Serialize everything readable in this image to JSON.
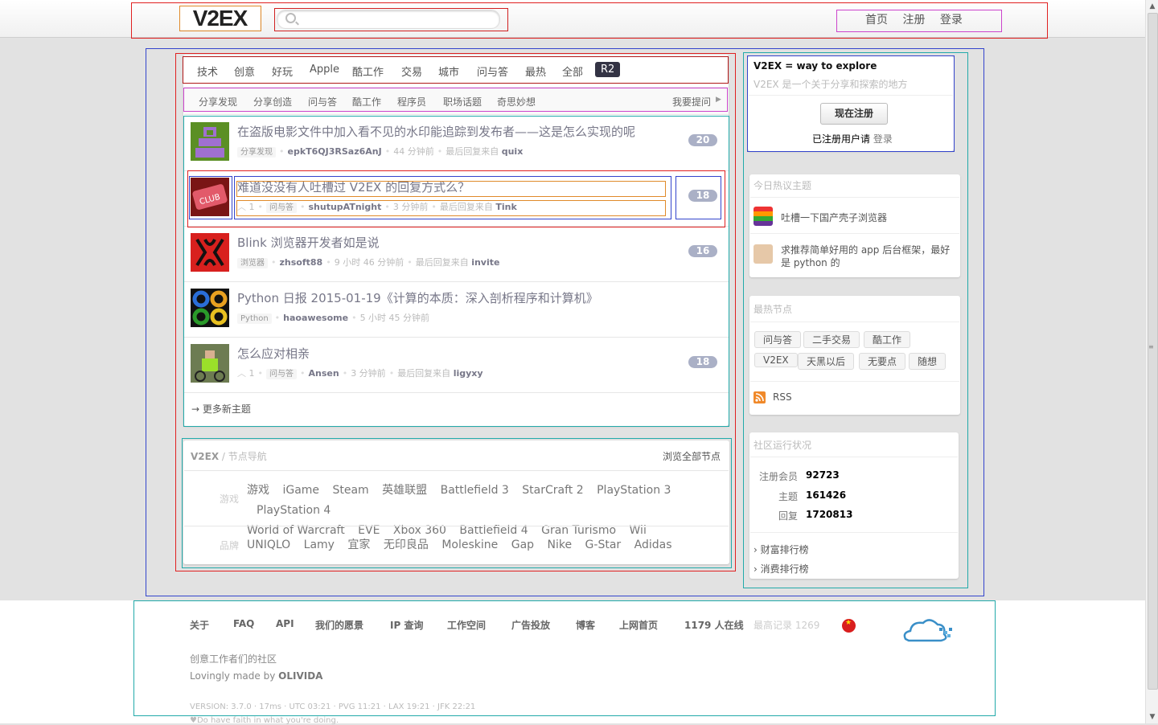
{
  "header": {
    "logo": "V2EX",
    "search_placeholder": "",
    "nav": [
      "首页",
      "注册",
      "登录"
    ]
  },
  "tabs": [
    "技术",
    "创意",
    "好玩",
    "Apple",
    "酷工作",
    "交易",
    "城市",
    "问与答",
    "最热",
    "全部",
    "R2"
  ],
  "subtabs": [
    "分享发现",
    "分享创造",
    "问与答",
    "酷工作",
    "程序员",
    "职场话题",
    "奇思妙想"
  ],
  "ask_link": "我要提问",
  "topics": [
    {
      "title": "在盗版电影文件中加入看不见的水印能追踪到发布者——这是怎么实现的呢",
      "votes": "",
      "node": "分享发现",
      "user": "epkT6QJ3RSaz6AnJ",
      "time": "44 分钟前",
      "last_prefix": "最后回复来自",
      "last_user": "quix",
      "count": "20"
    },
    {
      "title": "难道没没有人吐槽过 V2EX 的回复方式么？",
      "votes": "1",
      "node": "问与答",
      "user": "shutupATnight",
      "time": "3 分钟前",
      "last_prefix": "最后回复来自",
      "last_user": "Tink",
      "count": "18"
    },
    {
      "title": "Blink 浏览器开发者如是说",
      "votes": "",
      "node": "浏览器",
      "user": "zhsoft88",
      "time": "9 小时 46 分钟前",
      "last_prefix": "最后回复来自",
      "last_user": "invite",
      "count": "16"
    },
    {
      "title": "Python 日报 2015-01-19《计算的本质：深入剖析程序和计算机》",
      "votes": "",
      "node": "Python",
      "user": "haoawesome",
      "time": "5 小时 45 分钟前",
      "last_prefix": "",
      "last_user": "",
      "count": ""
    },
    {
      "title": "怎么应对相亲",
      "votes": "1",
      "node": "问与答",
      "user": "Ansen",
      "time": "3 分钟前",
      "last_prefix": "最后回复来自",
      "last_user": "ligyxy",
      "count": "18"
    }
  ],
  "more_topics": "更多新主题",
  "nodes_nav": {
    "brand": "V2EX",
    "sep": " / ",
    "title": "节点导航",
    "browse_all": "浏览全部节点",
    "groups": [
      {
        "label": "游戏",
        "items": [
          "游戏",
          "iGame",
          "Steam",
          "英雄联盟",
          "Battlefield 3",
          "StarCraft 2",
          "PlayStation 3",
          "PlayStation 4",
          "World of Warcraft",
          "EVE",
          "Xbox 360",
          "Battlefield 4",
          "Gran Turismo",
          "Wii"
        ]
      },
      {
        "label": "品牌",
        "items": [
          "UNIQLO",
          "Lamy",
          "宜家",
          "无印良品",
          "Moleskine",
          "Gap",
          "Nike",
          "G-Star",
          "Adidas"
        ]
      }
    ]
  },
  "sidebar": {
    "intro_title": "V2EX = way to explore",
    "intro_sub": "V2EX 是一个关于分享和探索的地方",
    "signup_button": "现在注册",
    "registered_text": "已注册用户请",
    "login_link": "登录",
    "hot_title": "今日热议主题",
    "hot_topics": [
      "吐槽一下国产壳子浏览器",
      "求推荐简单好用的 app 后台框架，最好是 python 的"
    ],
    "hot_nodes_title": "最热节点",
    "hot_nodes": [
      "问与答",
      "二手交易",
      "酷工作",
      "V2EX",
      "天黑以后",
      "无要点",
      "随想"
    ],
    "rss": "RSS",
    "stats_title": "社区运行状况",
    "stats": [
      {
        "label": "注册会员",
        "value": "92723"
      },
      {
        "label": "主题",
        "value": "161426"
      },
      {
        "label": "回复",
        "value": "1720813"
      }
    ],
    "rank_links": [
      "财富排行榜",
      "消费排行榜"
    ]
  },
  "footer": {
    "links": [
      "关于",
      "FAQ",
      "API",
      "我们的愿景",
      "IP 查询",
      "工作空间",
      "广告投放",
      "博客",
      "上网首页",
      "1179 人在线"
    ],
    "record": "最高记录 1269",
    "tagline": "创意工作者们的社区",
    "made_prefix": "Lovingly made by",
    "made_by": "OLIVIDA",
    "version": "VERSION: 3.7.0 · 17ms · UTC 03:21 · PVG 11:21 · LAX 19:21 · JFK 22:21",
    "faith": "♥Do have faith in what you're doing."
  },
  "colors": {
    "accent_badge": "#aab0c6",
    "current_tab": "#333344",
    "outline_red": "#e02020",
    "outline_purple": "#cc44cc",
    "outline_blue": "#3344cc",
    "outline_teal": "#22aaaa",
    "outline_orange": "#e08a2a"
  }
}
